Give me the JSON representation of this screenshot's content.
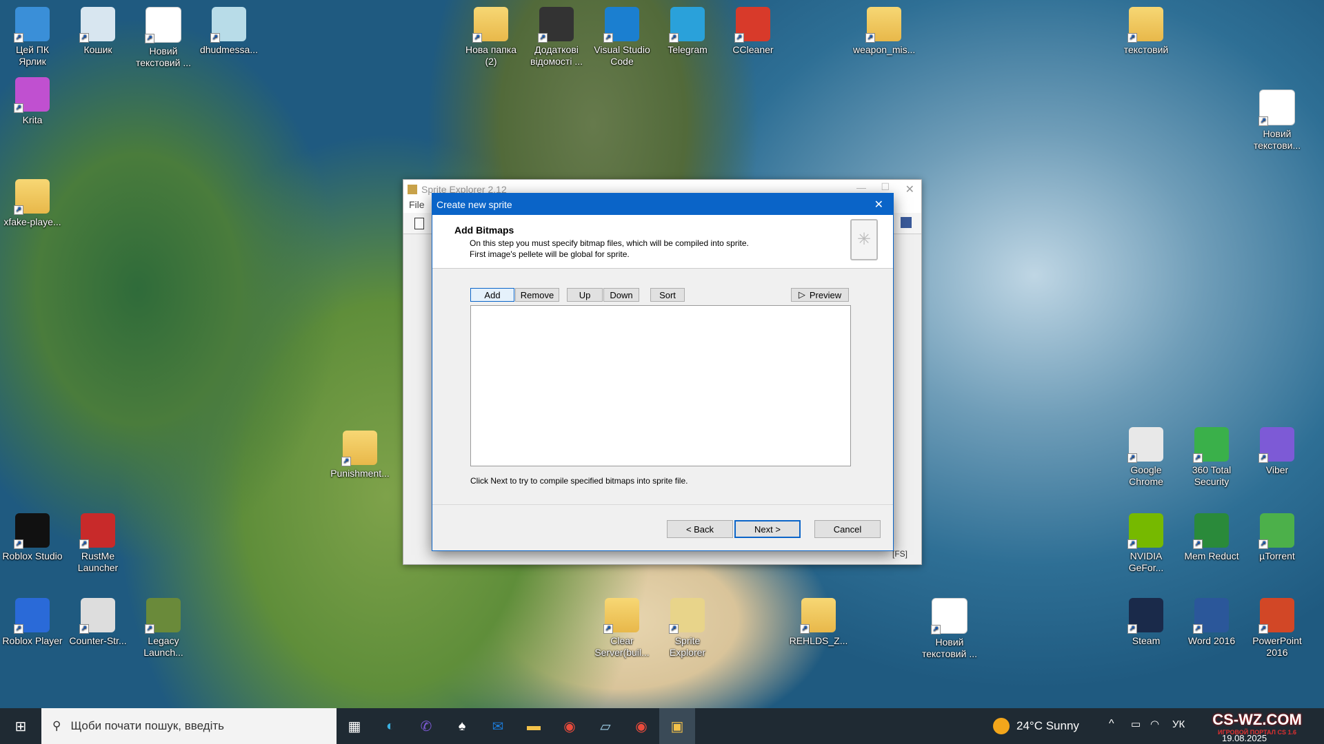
{
  "desktop_icons": [
    {
      "label": "Цей ПК Ярлик",
      "icon": "this-pc-icon"
    },
    {
      "label": "Кошик",
      "icon": "recycle-bin-icon"
    },
    {
      "label": "Новий текстовий ...",
      "icon": "text-file-icon"
    },
    {
      "label": "dhudmessa...",
      "icon": "file-icon"
    },
    {
      "label": "Krita",
      "icon": "krita-icon"
    },
    {
      "label": "xfake-playe...",
      "icon": "folder-icon"
    },
    {
      "label": "Нова папка (2)",
      "icon": "folder-icon"
    },
    {
      "label": "Додаткові відомості ...",
      "icon": "info-icon"
    },
    {
      "label": "Visual Studio Code",
      "icon": "vscode-icon"
    },
    {
      "label": "Telegram",
      "icon": "telegram-icon"
    },
    {
      "label": "CCleaner",
      "icon": "ccleaner-icon"
    },
    {
      "label": "weapon_mis...",
      "icon": "folder-icon"
    },
    {
      "label": "текстовий",
      "icon": "folder-icon"
    },
    {
      "label": "Новий текстови...",
      "icon": "text-file-icon"
    },
    {
      "label": "Punishment...",
      "icon": "folder-icon"
    },
    {
      "label": "Google Chrome",
      "icon": "chrome-icon"
    },
    {
      "label": "360 Total Security",
      "icon": "security-icon"
    },
    {
      "label": "Viber",
      "icon": "viber-icon"
    },
    {
      "label": "NVIDIA GeFor...",
      "icon": "nvidia-icon"
    },
    {
      "label": "Mem Reduct",
      "icon": "memreduct-icon"
    },
    {
      "label": "µTorrent",
      "icon": "utorrent-icon"
    },
    {
      "label": "Roblox Studio",
      "icon": "roblox-studio-icon"
    },
    {
      "label": "RustMe Launcher",
      "icon": "rustme-icon"
    },
    {
      "label": "Roblox Player",
      "icon": "roblox-icon"
    },
    {
      "label": "Counter-Str...",
      "icon": "counter-strike-icon"
    },
    {
      "label": "Legacy Launch...",
      "icon": "minecraft-icon"
    },
    {
      "label": "Clear Server(buil...",
      "icon": "folder-icon"
    },
    {
      "label": "Sprite Explorer",
      "icon": "sprite-explorer-icon"
    },
    {
      "label": "REHLDS_Z...",
      "icon": "folder-icon"
    },
    {
      "label": "Новий текстовий ...",
      "icon": "text-file-icon"
    },
    {
      "label": "Steam",
      "icon": "steam-icon"
    },
    {
      "label": "Word 2016",
      "icon": "word-icon"
    },
    {
      "label": "PowerPoint 2016",
      "icon": "powerpoint-icon"
    }
  ],
  "background_window": {
    "title": "Sprite Explorer 2.12",
    "menu_file": "File",
    "status": "[FS]"
  },
  "dialog": {
    "title": "Create new sprite",
    "heading": "Add Bitmaps",
    "desc_line1": "On this step you must specify bitmap files, which will be compiled into sprite.",
    "desc_line2": "First image's pellete will be global for sprite.",
    "buttons": {
      "add": "Add",
      "remove": "Remove",
      "up": "Up",
      "down": "Down",
      "sort": "Sort",
      "preview": "Preview"
    },
    "hint": "Click Next to try to compile specified bitmaps into sprite file.",
    "back": "< Back",
    "next": "Next >",
    "cancel": "Cancel"
  },
  "taskbar": {
    "search_placeholder": "Щоби почати пошук, введіть",
    "weather": "24°C  Sunny",
    "lang": "УК",
    "date": "19.08.2025",
    "watermark": "CS-WZ.COM",
    "watermark_sub": "ИГРОВОЙ ПОРТАЛ CS 1.6"
  },
  "colors": {
    "accent": "#0a64c8",
    "taskbar": "#1f2a33"
  }
}
